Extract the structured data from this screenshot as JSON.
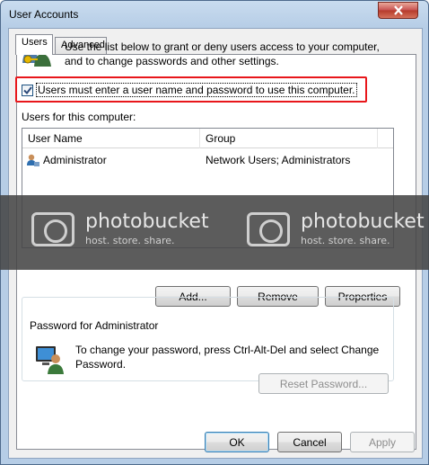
{
  "window": {
    "title": "User Accounts"
  },
  "tabs": [
    {
      "label": "Users"
    },
    {
      "label": "Advanced"
    }
  ],
  "intro": {
    "text": "Use the list below to grant or deny users access to your computer, and to change passwords and other settings."
  },
  "checkbox": {
    "checked": true,
    "label": "Users must enter a user name and password to use this computer."
  },
  "users_section": {
    "label": "Users for this computer:"
  },
  "table": {
    "columns": [
      "User Name",
      "Group"
    ],
    "rows": [
      {
        "user_name": "Administrator",
        "group": "Network Users; Administrators"
      }
    ]
  },
  "watermark": {
    "brand": "photobucket",
    "tagline": "host. store. share."
  },
  "actions": {
    "add": "Add...",
    "remove": "Remove",
    "properties": "Properties"
  },
  "password_group": {
    "title": "Password for Administrator",
    "text": "To change your password, press Ctrl-Alt-Del and select Change Password.",
    "reset_button": "Reset Password..."
  },
  "dialog_buttons": {
    "ok": "OK",
    "cancel": "Cancel",
    "apply": "Apply"
  },
  "colors": {
    "highlight_border": "#e8171b",
    "close_button": "#c75050",
    "titlebar": "#b6cde6"
  }
}
